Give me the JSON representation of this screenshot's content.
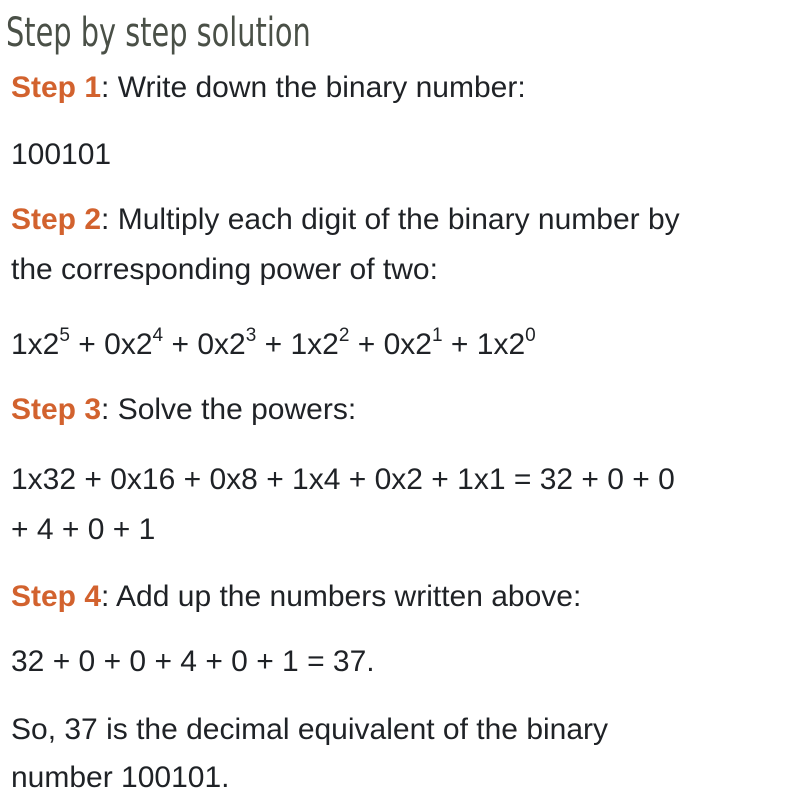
{
  "title": "Step by step solution",
  "accent_color": "#d2622e",
  "steps": [
    {
      "label": "Step 1",
      "text_lines": [
        ": Write down the binary number:"
      ]
    },
    {
      "label": "Step 2",
      "text_lines": [
        ": Multiply each digit of the binary number by",
        "the corresponding power of two:"
      ]
    },
    {
      "label": "Step 3",
      "text_lines": [
        ": Solve the powers:"
      ]
    },
    {
      "label": "Step 4",
      "text_lines": [
        ": Add up the numbers written above:"
      ]
    }
  ],
  "binary_number": "100101",
  "powers_terms": [
    {
      "coef": "1x2",
      "exp": "5",
      "sep": " + "
    },
    {
      "coef": "0x2",
      "exp": "4",
      "sep": " + "
    },
    {
      "coef": "0x2",
      "exp": "3",
      "sep": " + "
    },
    {
      "coef": "1x2",
      "exp": "2",
      "sep": " + "
    },
    {
      "coef": "0x2",
      "exp": "1",
      "sep": " + "
    },
    {
      "coef": "1x2",
      "exp": "0",
      "sep": ""
    }
  ],
  "solved_lines": [
    "1x32 + 0x16 + 0x8 + 1x4 + 0x2 + 1x1 = 32 + 0 + 0",
    "+ 4 + 0 + 1"
  ],
  "sum_line": "32 + 0 + 0 + 4 + 0 + 1 = 37.",
  "conclusion_lines": [
    "So, 37 is the decimal equivalent of the binary",
    "number 100101."
  ]
}
